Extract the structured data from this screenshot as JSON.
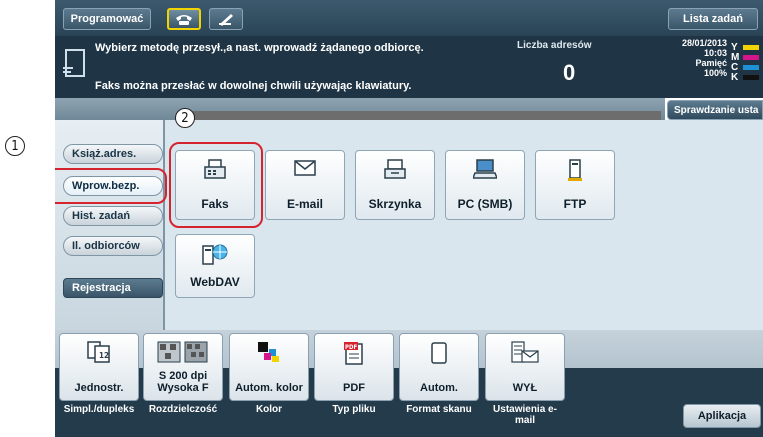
{
  "topbar": {
    "mode_label": "Programować",
    "job_list_label": "Lista zadań"
  },
  "message": {
    "line1": "Wybierz metodę przesył.,a nast. wprowadź żądanego odbiorcę.",
    "line2": "Faks można przesłać w dowolnej chwili używając klawiatury.",
    "address_count_label": "Liczba adresów",
    "address_count": "0",
    "date": "28/01/2013",
    "time": "10:03",
    "memory_label": "Pamięć",
    "memory_value": "100%",
    "toner_letters": [
      "Y",
      "M",
      "C",
      "K"
    ],
    "toner_colors": [
      "#f2d400",
      "#d6148c",
      "#1e90d6",
      "#111111"
    ]
  },
  "status_check_label": "Sprawdzanie usta",
  "callouts": [
    "1",
    "2"
  ],
  "side_tabs": [
    {
      "label": "Książ.adres."
    },
    {
      "label": "Wprow.bezp."
    },
    {
      "label": "Hist. zadań"
    },
    {
      "label": "Il. odbiorców"
    },
    {
      "label": "Rejestracja"
    }
  ],
  "destinations": [
    {
      "label": "Faks",
      "icon": "fax-icon"
    },
    {
      "label": "E-mail",
      "icon": "envelope-icon"
    },
    {
      "label": "Skrzynka",
      "icon": "box-icon"
    },
    {
      "label": "PC (SMB)",
      "icon": "computer-icon"
    },
    {
      "label": "FTP",
      "icon": "ftp-server-icon"
    },
    {
      "label": "WebDAV",
      "icon": "webdav-icon"
    }
  ],
  "functions": [
    {
      "value": "Jednostr.",
      "caption": "Simpl./dupleks",
      "icon": "simplex-icon"
    },
    {
      "value": "S 200 dpi Wysoka F",
      "caption": "Rozdzielczość",
      "icon": "resolution-icon"
    },
    {
      "value": "Autom. kolor",
      "caption": "Kolor",
      "icon": "color-icon"
    },
    {
      "value": "PDF",
      "caption": "Typ pliku",
      "icon": "pdf-icon"
    },
    {
      "value": "Autom.",
      "caption": "Format skanu",
      "icon": "page-icon"
    },
    {
      "value": "WYŁ",
      "caption": "Ustawienia e-mail",
      "icon": "email-settings-icon"
    }
  ],
  "application_label": "Aplikacja",
  "colors": {
    "highlight": "#d6242f",
    "panel_dark": "#1f3545",
    "panel_light": "#d9e6ee"
  }
}
